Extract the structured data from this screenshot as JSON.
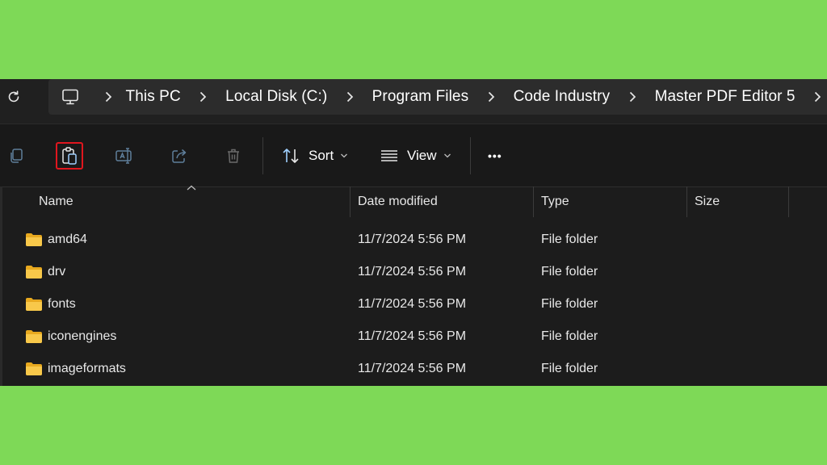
{
  "breadcrumb": [
    "This PC",
    "Local Disk (C:)",
    "Program Files",
    "Code Industry",
    "Master PDF Editor 5"
  ],
  "toolbar": {
    "sort_label": "Sort",
    "view_label": "View",
    "more_label": "•••"
  },
  "columns": [
    "Name",
    "Date modified",
    "Type",
    "Size"
  ],
  "rows": [
    {
      "name": "amd64",
      "date": "11/7/2024 5:56 PM",
      "type": "File folder"
    },
    {
      "name": "drv",
      "date": "11/7/2024 5:56 PM",
      "type": "File folder"
    },
    {
      "name": "fonts",
      "date": "11/7/2024 5:56 PM",
      "type": "File folder"
    },
    {
      "name": "iconengines",
      "date": "11/7/2024 5:56 PM",
      "type": "File folder"
    },
    {
      "name": "imageformats",
      "date": "11/7/2024 5:56 PM",
      "type": "File folder"
    }
  ],
  "colors": {
    "background": "#7ed957",
    "window": "#1c1c1c",
    "highlight": "#e0161e",
    "folder": "#f8c84a"
  },
  "icons": {
    "refresh": "refresh-icon",
    "pc": "this-pc-icon",
    "copy": "copy-icon",
    "paste": "paste-icon",
    "rename": "rename-icon",
    "share": "share-icon",
    "delete": "delete-icon",
    "sort": "sort-icon",
    "view": "view-list-icon",
    "folder": "folder-icon"
  }
}
